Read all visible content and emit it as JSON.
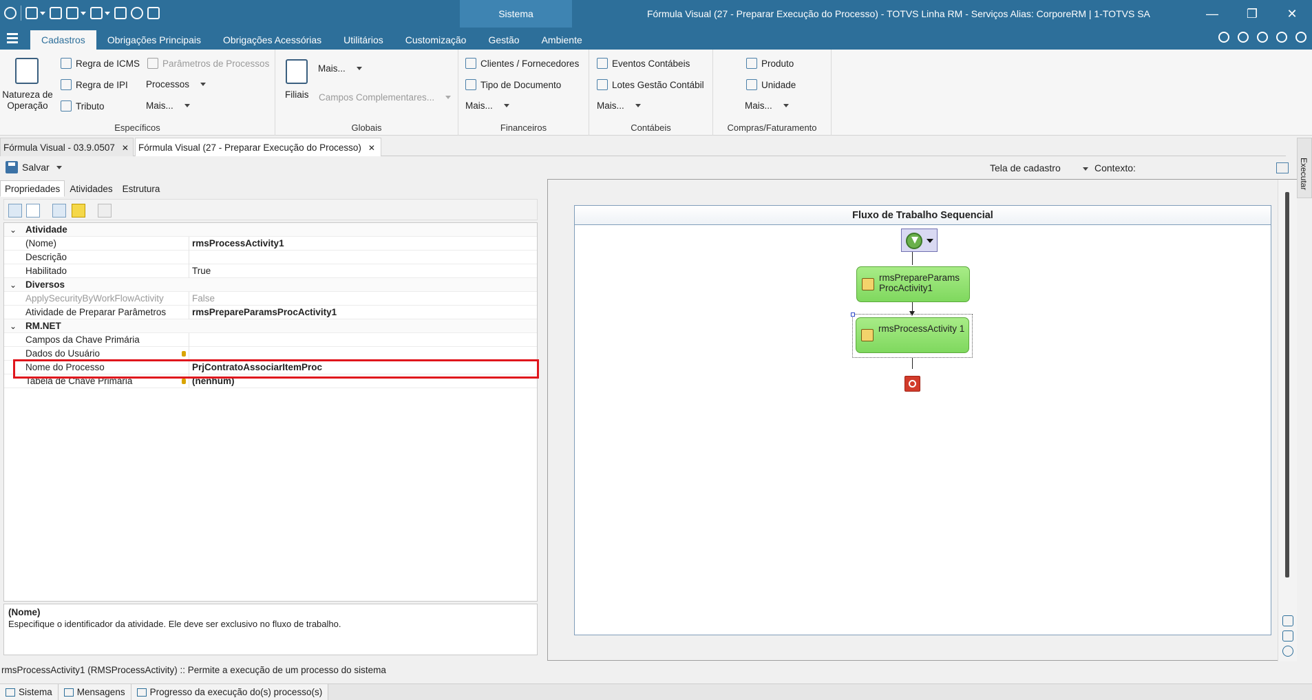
{
  "titlebar": {
    "context_tab": "Sistema",
    "window_title": "Fórmula Visual (27 - Preparar Execução do Processo) - TOTVS Linha RM - Serviços  Alias: CorporeRM | 1-TOTVS SA",
    "minimize": "—",
    "restore": "❐",
    "close": "✕"
  },
  "ribbon_tabs": [
    "Cadastros",
    "Obrigações Principais",
    "Obrigações Acessórias",
    "Utilitários",
    "Customização",
    "Gestão",
    "Ambiente"
  ],
  "ribbon": {
    "especificos": {
      "label": "Específicos",
      "natureza": "Natureza de Operação",
      "natureza_line1": "Natureza de",
      "natureza_line2": "Operação",
      "regra_icms": "Regra de ICMS",
      "regra_ipi": "Regra de IPI",
      "tributo": "Tributo",
      "parametros": "Parâmetros de Processos",
      "processos": "Processos",
      "mais": "Mais..."
    },
    "globais": {
      "label": "Globais",
      "filiais": "Filiais",
      "mais": "Mais...",
      "campos": "Campos Complementares..."
    },
    "financeiros": {
      "label": "Financeiros",
      "clientes": "Clientes / Fornecedores",
      "tipo_doc": "Tipo de Documento",
      "mais": "Mais..."
    },
    "contabeis": {
      "label": "Contábeis",
      "eventos": "Eventos Contábeis",
      "lotes": "Lotes Gestão Contábil",
      "mais": "Mais..."
    },
    "compras": {
      "label": "Compras/Faturamento",
      "produto": "Produto",
      "unidade": "Unidade",
      "mais": "Mais..."
    }
  },
  "doc_tabs": [
    {
      "label": "Fórmula Visual - 03.9.0507"
    },
    {
      "label": "Fórmula Visual (27 - Preparar Execução do Processo)"
    }
  ],
  "right_strip": "Executar",
  "toolbar": {
    "save": "Salvar",
    "tela": "Tela de cadastro",
    "contexto": "Contexto:"
  },
  "panel_tabs": [
    "Propriedades",
    "Atividades",
    "Estrutura"
  ],
  "properties": {
    "cat_atividade": "Atividade",
    "nome_label": "(Nome)",
    "nome_value": "rmsProcessActivity1",
    "descricao_label": "Descrição",
    "habilitado_label": "Habilitado",
    "habilitado_value": "True",
    "cat_diversos": "Diversos",
    "apply_label": "ApplySecurityByWorkFlowActivity",
    "apply_value": "False",
    "preparar_label": "Atividade de Preparar Parâmetros",
    "preparar_value": "rmsPrepareParamsProcActivity1",
    "cat_rmnet": "RM.NET",
    "campos_label": "Campos da Chave Primária",
    "dados_label": "Dados do Usuário",
    "processo_label": "Nome do Processo",
    "processo_value": "PrjContratoAssociarItemProc",
    "tabela_label": "Tabela de Chave Primária",
    "tabela_value": "(nenhum)"
  },
  "description": {
    "title": "(Nome)",
    "text": "Especifique o identificador da atividade. Ele deve ser exclusivo no fluxo de trabalho."
  },
  "designer": {
    "title": "Fluxo de Trabalho Sequencial",
    "activity1": "rmsPrepareParams ProcActivity1",
    "activity2": "rmsProcessActivity 1"
  },
  "status_line": "rmsProcessActivity1  (RMSProcessActivity)  :: Permite a execução de um processo do sistema",
  "bottom_tabs": [
    "Sistema",
    "Mensagens",
    "Progresso da execução do(s) processo(s)"
  ]
}
